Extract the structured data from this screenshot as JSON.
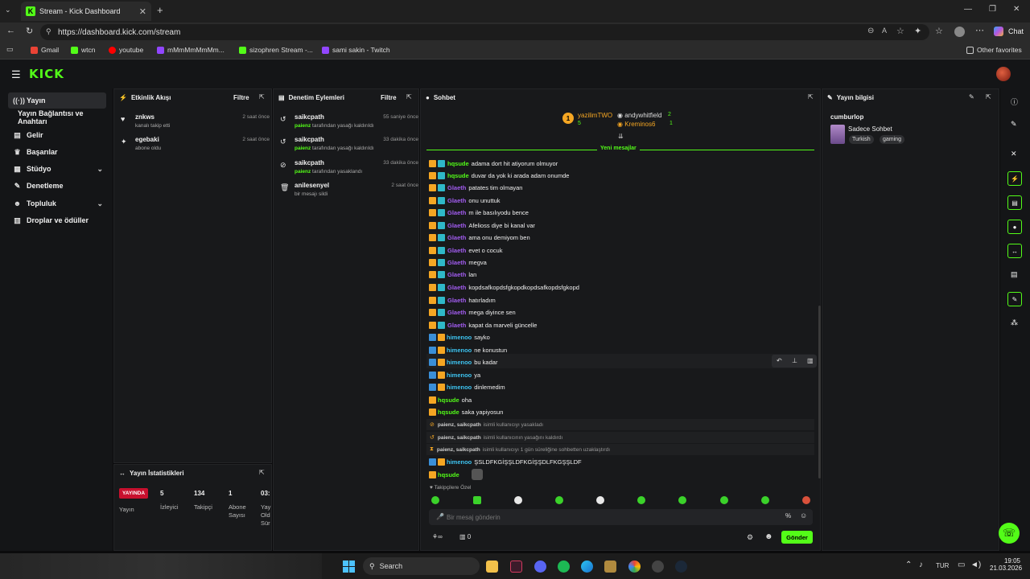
{
  "browser": {
    "tab_title": "Stream - Kick Dashboard",
    "url": "https://dashboard.kick.com/stream",
    "chat_label": "Chat",
    "bookmarks": [
      "Gmail",
      "wtcn",
      "youtube",
      "mMmMmMmMm...",
      "sizophren Stream -...",
      "sami sakin - Twitch"
    ],
    "other_favorites": "Other favorites"
  },
  "logo": "KICK",
  "sidebar": {
    "items": [
      {
        "label": "Yayın",
        "icon": "broadcast-icon"
      },
      {
        "label": "Yayın Bağlantısı ve Anahtarı",
        "icon": "key-icon"
      },
      {
        "label": "Gelir",
        "icon": "revenue-icon"
      },
      {
        "label": "Başarılar",
        "icon": "trophy-icon"
      },
      {
        "label": "Stüdyo",
        "icon": "studio-icon"
      },
      {
        "label": "Denetleme",
        "icon": "wrench-icon"
      },
      {
        "label": "Topluluk",
        "icon": "community-icon"
      },
      {
        "label": "Droplar ve ödüller",
        "icon": "gift-icon"
      }
    ]
  },
  "activity": {
    "title": "Etkinlik Akışı",
    "filter": "Filtre",
    "items": [
      {
        "name": "znkws",
        "sub": "kanalı takip etti",
        "time": "2 saat önce"
      },
      {
        "name": "egebaki",
        "sub": "abone oldu",
        "time": "2 saat önce"
      }
    ]
  },
  "moderation": {
    "title": "Denetim Eylemleri",
    "filter": "Filtre",
    "items": [
      {
        "name": "saikcpath",
        "mod": "paienz",
        "sub": "tarafından yasağı kaldırıldı",
        "time": "55 saniye önce"
      },
      {
        "name": "saikcpath",
        "mod": "paienz",
        "sub": "tarafından yasağı kaldırıldı",
        "time": "33 dakika önce"
      },
      {
        "name": "saikcpath",
        "mod": "paienz",
        "sub": "tarafından yasaklandı",
        "time": "33 dakika önce"
      },
      {
        "name": "anilesenyel",
        "mod": "",
        "sub": "bir mesajı sildi",
        "time": "2 saat önce"
      }
    ]
  },
  "stats": {
    "title": "Yayın İstatistikleri",
    "live_badge": "YAYINDA",
    "live_label": "Yayın",
    "viewers_value": "5",
    "viewers_label": "İzleyici",
    "followers_value": "134",
    "followers_label": "Takipçi",
    "subs_value": "1",
    "subs_label": "Abone Sayısı",
    "duration_value": "03:",
    "duration_label": "Yay Old Sür"
  },
  "chat": {
    "title": "Sohbet",
    "top": [
      {
        "rank": "1",
        "name": "yazilimTWO",
        "count": "5"
      },
      {
        "name": "andywhitfield",
        "count": "2"
      },
      {
        "name": "Kreminos6",
        "count": "1"
      }
    ],
    "new_messages": "Yeni mesajlar",
    "messages": [
      {
        "user": "hqsude",
        "text": "adama dort hit atiyorum olmuyor",
        "color": "#53fc18",
        "badges": "crown-sub"
      },
      {
        "user": "hqsude",
        "text": "duvar da yok ki arada adam onumde",
        "color": "#53fc18",
        "badges": "crown-sub"
      },
      {
        "user": "Glaeth",
        "text": "patates tim olmayan",
        "color": "#a25cf0",
        "badges": "crown-sub"
      },
      {
        "user": "Glaeth",
        "text": "onu unuttuk",
        "color": "#a25cf0",
        "badges": "crown-sub"
      },
      {
        "user": "Glaeth",
        "text": "m ile basılıyodu bence",
        "color": "#a25cf0",
        "badges": "crown-sub"
      },
      {
        "user": "Glaeth",
        "text": "Afelioss diye bi kanal var",
        "color": "#a25cf0",
        "badges": "crown-sub"
      },
      {
        "user": "Glaeth",
        "text": "ama onu demiyom ben",
        "color": "#a25cf0",
        "badges": "crown-sub"
      },
      {
        "user": "Glaeth",
        "text": "evet o cocuk",
        "color": "#a25cf0",
        "badges": "crown-sub"
      },
      {
        "user": "Glaeth",
        "text": "megva",
        "color": "#a25cf0",
        "badges": "crown-sub"
      },
      {
        "user": "Glaeth",
        "text": "lan",
        "color": "#a25cf0",
        "badges": "crown-sub"
      },
      {
        "user": "Glaeth",
        "text": "kopdsafkopdsfgkopdkopdsafkopdsfgkopd",
        "color": "#a25cf0",
        "badges": "crown-sub"
      },
      {
        "user": "Glaeth",
        "text": "hatırladım",
        "color": "#a25cf0",
        "badges": "crown-sub"
      },
      {
        "user": "Glaeth",
        "text": "mega diyince sen",
        "color": "#a25cf0",
        "badges": "crown-sub"
      },
      {
        "user": "Glaeth",
        "text": "kapat da marveli güncelle",
        "color": "#a25cf0",
        "badges": "crown-sub"
      },
      {
        "user": "himenoo",
        "text": "sayko",
        "color": "#3dc3f0",
        "badges": "mod-crown"
      },
      {
        "user": "himenoo",
        "text": "ne konustun",
        "color": "#3dc3f0",
        "badges": "mod-crown"
      },
      {
        "user": "himenoo",
        "text": "bu kadar",
        "color": "#3dc3f0",
        "badges": "mod-crown"
      },
      {
        "user": "himenoo",
        "text": "ya",
        "color": "#3dc3f0",
        "badges": "mod-crown"
      },
      {
        "user": "himenoo",
        "text": "dinlemedim",
        "color": "#3dc3f0",
        "badges": "mod-crown"
      },
      {
        "user": "hqsude",
        "text": "oha",
        "color": "#53fc18",
        "badges": "crown"
      },
      {
        "user": "hqsude",
        "text": "saka yapiyosun",
        "color": "#53fc18",
        "badges": "crown"
      }
    ],
    "system": [
      {
        "who": "paienz, saikcpath",
        "text": "isimli kullanıcıyı yasakladı"
      },
      {
        "who": "paienz, saikcpath",
        "text": "isimli kullanıcının yasağını kaldırdı"
      },
      {
        "who": "paienz, saikcpath",
        "text": "isimli kullanıcıyı 1 gün süreliğine sohbetten uzaklaştırdı"
      }
    ],
    "after": [
      {
        "user": "himenoo",
        "text": "ŞSLDFKGİŞŞLDFKGİŞŞDLFKGŞŞLDF",
        "color": "#3dc3f0"
      },
      {
        "user": "hqsude",
        "text": "",
        "color": "#53fc18"
      }
    ],
    "followers_only": "Takipçilere Özel",
    "input_placeholder": "Bir mesaj gönderin",
    "points": "0",
    "send_label": "Gönder"
  },
  "stream_info": {
    "title": "Yayın bilgisi",
    "channel": "cumburlop",
    "stream_title": "Sadece Sohbet",
    "tags": [
      "Turkish",
      "gaming"
    ]
  },
  "taskbar": {
    "search": "Search",
    "lang": "TUR",
    "time": "19:05",
    "date": "21.03.2026"
  },
  "colors": {
    "accent": "#53fc18",
    "live": "#c8102e"
  }
}
